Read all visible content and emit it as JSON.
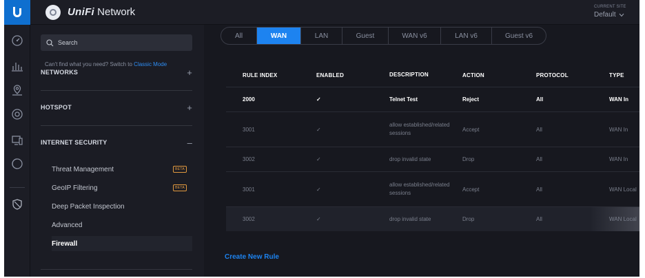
{
  "app": {
    "brand": "UniFi",
    "product": "Network"
  },
  "site": {
    "label": "CURRENT SITE",
    "value": "Default"
  },
  "rail_icons": [
    "dashboard-icon",
    "statistics-icon",
    "map-icon",
    "devices-icon",
    "clients-icon",
    "insights-icon",
    "settings-icon"
  ],
  "sidebar": {
    "search_placeholder": "Search",
    "hint_text": "Can't find what you need? Switch to ",
    "hint_link": "Classic Mode",
    "sections": [
      {
        "label": "NETWORKS",
        "toggle": "+"
      },
      {
        "label": "HOTSPOT",
        "toggle": "+"
      },
      {
        "label": "INTERNET SECURITY",
        "toggle": "–"
      }
    ],
    "items": [
      {
        "label": "Threat Management",
        "badge": "BETA"
      },
      {
        "label": "GeoIP Filtering",
        "badge": "BETA"
      },
      {
        "label": "Deep Packet Inspection"
      },
      {
        "label": "Advanced"
      },
      {
        "label": "Firewall"
      }
    ]
  },
  "tabs": [
    "All",
    "WAN",
    "LAN",
    "Guest",
    "WAN v6",
    "LAN v6",
    "Guest v6"
  ],
  "active_tab": "WAN",
  "table": {
    "headers": [
      "RULE INDEX",
      "ENABLED",
      "DESCRIPTION",
      "ACTION",
      "PROTOCOL",
      "TYPE"
    ],
    "rows": [
      {
        "index": "2000",
        "enabled": "✓",
        "description": "Telnet Test",
        "action": "Reject",
        "protocol": "All",
        "type": "WAN In"
      },
      {
        "index": "3001",
        "enabled": "✓",
        "description": "allow established/related sessions",
        "action": "Accept",
        "protocol": "All",
        "type": "WAN In"
      },
      {
        "index": "3002",
        "enabled": "✓",
        "description": "drop invalid state",
        "action": "Drop",
        "protocol": "All",
        "type": "WAN In"
      },
      {
        "index": "3001",
        "enabled": "✓",
        "description": "allow established/related sessions",
        "action": "Accept",
        "protocol": "All",
        "type": "WAN Local"
      },
      {
        "index": "3002",
        "enabled": "✓",
        "description": "drop invalid state",
        "action": "Drop",
        "protocol": "All",
        "type": "WAN Local"
      }
    ]
  },
  "create_rule_label": "Create New Rule",
  "colors": {
    "accent": "#1d83f0",
    "logo": "#0f6fcf",
    "beta": "#e39a3f",
    "background": "#17181f"
  }
}
